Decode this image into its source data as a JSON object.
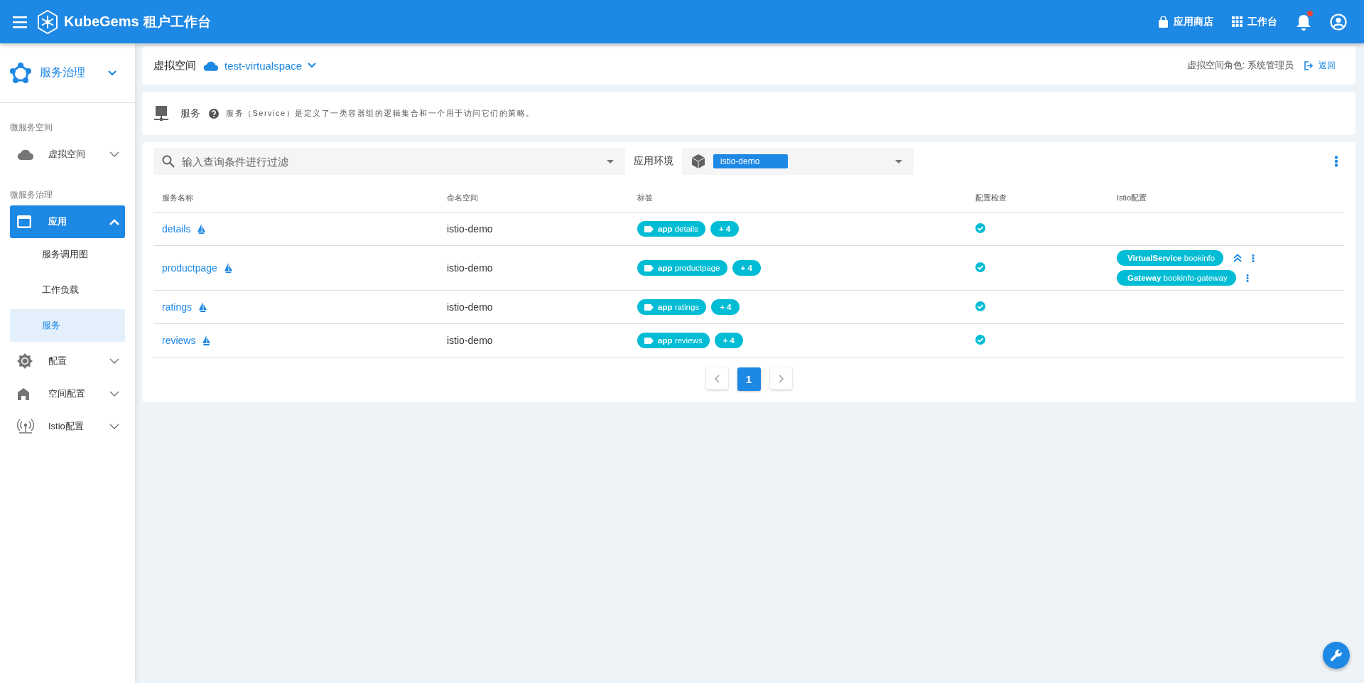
{
  "header": {
    "brand": "KubeGems",
    "subtitle": "租户工作台",
    "actions": [
      {
        "label": "应用商店"
      },
      {
        "label": "工作台"
      }
    ],
    "has_notification": true
  },
  "sidebar": {
    "module": "服务治理",
    "sections": [
      {
        "title": "微服务空间",
        "items": [
          {
            "label": "虚拟空间",
            "expanded": false,
            "selected": false
          }
        ]
      },
      {
        "title": "微服务治理",
        "items": [
          {
            "label": "应用",
            "expanded": true,
            "selected": true,
            "children": [
              {
                "label": "服务调用图",
                "selected": false
              },
              {
                "label": "工作负载",
                "selected": false
              },
              {
                "label": "服务",
                "selected": true
              }
            ]
          },
          {
            "label": "配置",
            "expanded": false,
            "selected": false
          },
          {
            "label": "空间配置",
            "expanded": false,
            "selected": false
          },
          {
            "label": "Istio配置",
            "expanded": false,
            "selected": false
          }
        ]
      }
    ]
  },
  "breadcrumb": {
    "label": "虚拟空间",
    "value": "test-virtualspace",
    "role": "虚拟空间角色: 系统管理员",
    "back": "返回"
  },
  "info": {
    "title": "服务",
    "description": "服务（Service）是定义了一类容器组的逻辑集合和一个用于访问它们的策略。"
  },
  "filter": {
    "placeholder": "输入查询条件进行过滤",
    "env_label": "应用环境",
    "env_value": "istio-demo"
  },
  "table": {
    "columns": [
      "服务名称",
      "命名空间",
      "标签",
      "配置检查",
      "Istio配置"
    ],
    "rows": [
      {
        "name": "details",
        "namespace": "istio-demo",
        "label": {
          "key": "app",
          "value": "details"
        },
        "more": "+ 4",
        "check_ok": true,
        "istio": []
      },
      {
        "name": "productpage",
        "namespace": "istio-demo",
        "label": {
          "key": "app",
          "value": "productpage"
        },
        "more": "+ 4",
        "check_ok": true,
        "istio": [
          {
            "type": "VirtualService",
            "name": "bookinfo",
            "collapsible": true
          },
          {
            "type": "Gateway",
            "name": "bookinfo-gateway",
            "collapsible": false
          }
        ]
      },
      {
        "name": "ratings",
        "namespace": "istio-demo",
        "label": {
          "key": "app",
          "value": "ratings"
        },
        "more": "+ 4",
        "check_ok": true,
        "istio": []
      },
      {
        "name": "reviews",
        "namespace": "istio-demo",
        "label": {
          "key": "app",
          "value": "reviews"
        },
        "more": "+ 4",
        "check_ok": true,
        "istio": []
      }
    ]
  },
  "pagination": {
    "pages": [
      {
        "label": "1",
        "selected": true
      }
    ]
  }
}
